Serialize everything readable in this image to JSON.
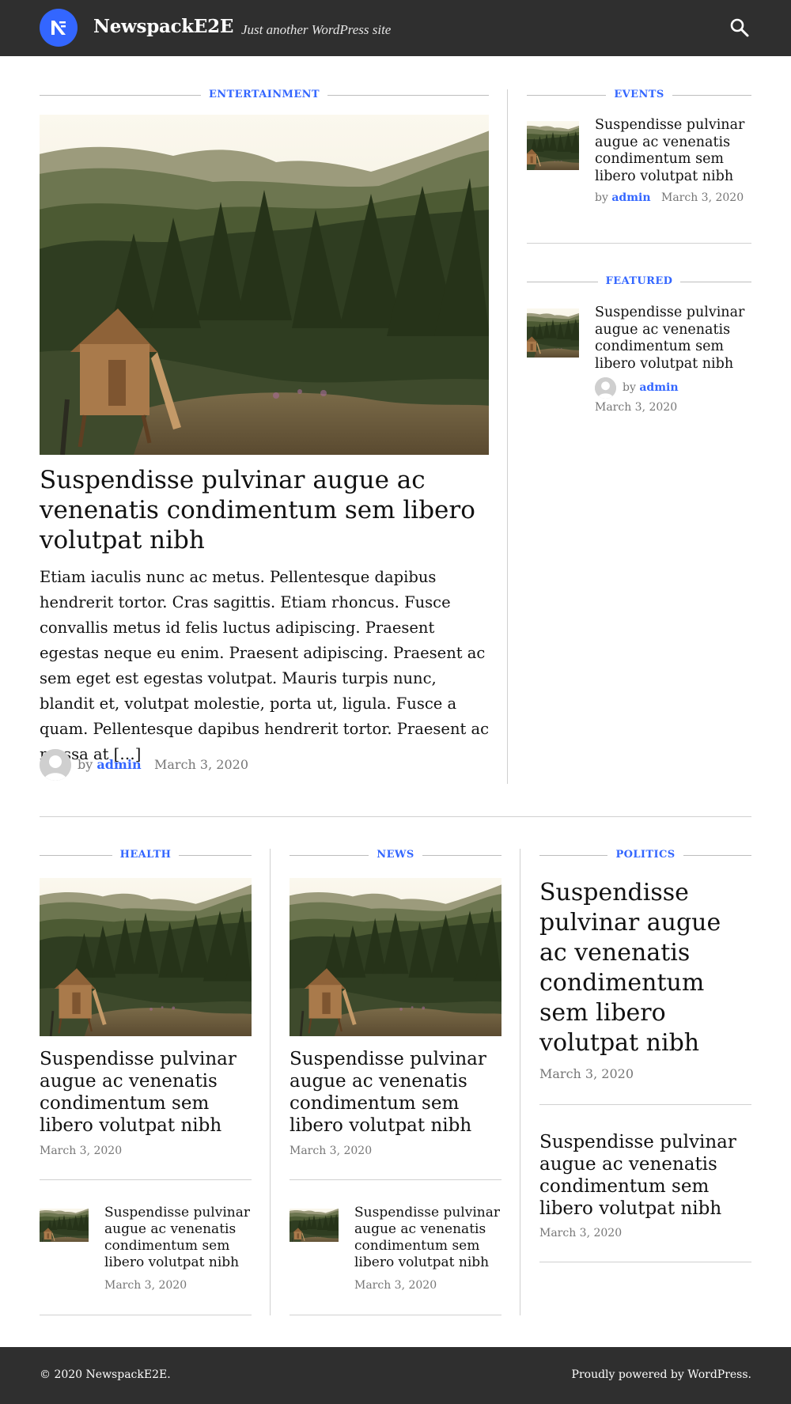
{
  "header": {
    "site_title": "NewspackE2E",
    "tagline": "Just another WordPress site"
  },
  "icons": [
    "newspack-logo-icon",
    "search-icon",
    "avatar-icon"
  ],
  "colors": {
    "accent": "#3366ff",
    "header_bg": "#2f2f2f",
    "meta": "#767676"
  },
  "top_section": {
    "entertainment": {
      "category": "ENTERTAINMENT",
      "title": "Suspendisse pulvinar augue ac venenatis condimentum sem libero volutpat nibh",
      "excerpt": "Etiam iaculis nunc ac metus. Pellentesque dapibus hendrerit tortor. Cras sagittis. Etiam rhoncus. Fusce convallis metus id felis luctus adipiscing. Praesent egestas neque eu enim. Praesent adipiscing. Praesent ac sem eget est egestas volutpat. Mauris turpis nunc, blandit et, volutpat molestie, porta ut, ligula. Fusce a quam. Pellentesque dapibus hendrerit tortor. Praesent ac massa at […]",
      "by": "by",
      "author": "admin",
      "date": "March 3, 2020"
    },
    "events": {
      "category": "EVENTS",
      "title": "Suspendisse pulvinar augue ac venenatis condimentum sem libero volutpat nibh",
      "by": "by",
      "author": "admin",
      "date": "March 3, 2020"
    },
    "featured": {
      "category": "FEATURED",
      "title": "Suspendisse pulvinar augue ac venenatis condimentum sem libero volutpat nibh",
      "by": "by",
      "author": "admin",
      "date": "March 3, 2020"
    }
  },
  "bottom_section": {
    "health": {
      "category": "HEALTH",
      "main_title": "Suspendisse pulvinar augue ac venenatis condimentum sem libero volutpat nibh",
      "main_date": "March 3, 2020",
      "small_title": "Suspendisse pulvinar augue ac venenatis condimentum sem libero volutpat nibh",
      "small_date": "March 3, 2020"
    },
    "news": {
      "category": "NEWS",
      "main_title": "Suspendisse pulvinar augue ac venenatis condimentum sem libero volutpat nibh",
      "main_date": "March 3, 2020",
      "small_title": "Suspendisse pulvinar augue ac venenatis condimentum sem libero volutpat nibh",
      "small_date": "March 3, 2020"
    },
    "politics": {
      "category": "POLITICS",
      "main_title": "Suspendisse pulvinar augue ac venenatis condimentum sem libero volutpat nibh",
      "main_date": "March 3, 2020",
      "second_title": "Suspendisse pulvinar augue ac venenatis condimentum sem libero volutpat nibh",
      "second_date": "March 3, 2020"
    }
  },
  "footer": {
    "copyright": "© 2020 NewspackE2E.",
    "powered": "Proudly powered by WordPress."
  }
}
